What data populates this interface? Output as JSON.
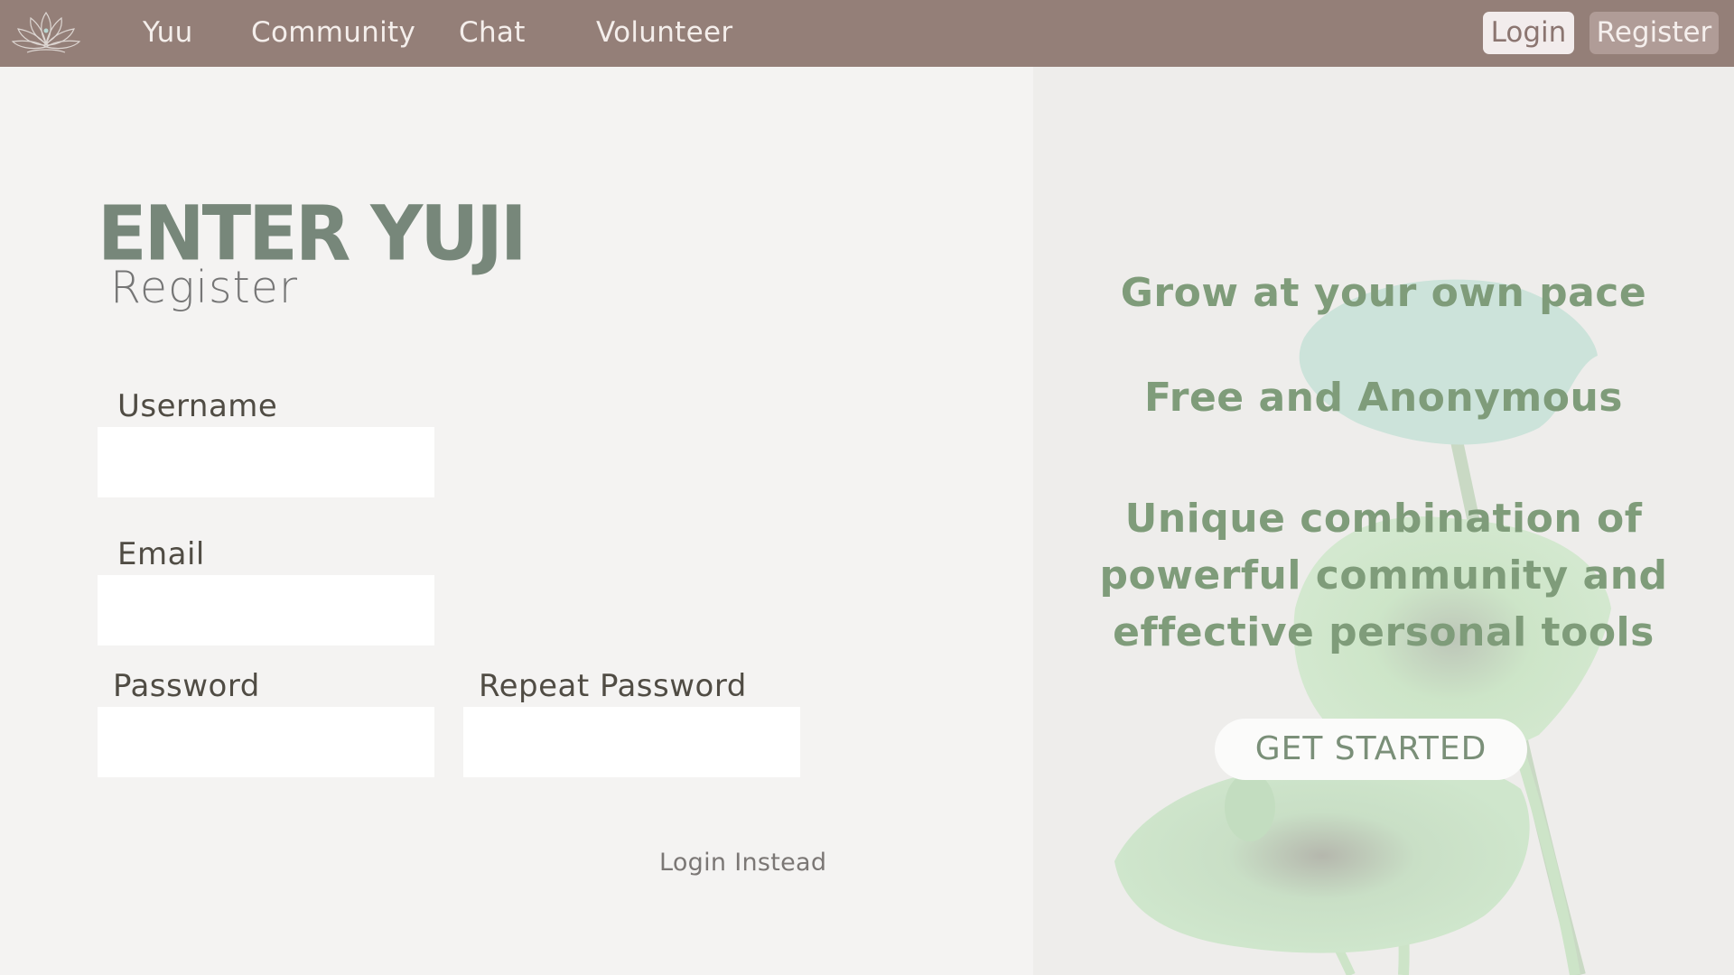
{
  "nav": {
    "links": [
      "Yuu",
      "Community",
      "Chat",
      "Volunteer"
    ],
    "login_label": "Login",
    "register_label": "Register"
  },
  "form": {
    "brand": "ENTER YUJI",
    "subtitle": "Register",
    "username_label": "Username",
    "username_value": "",
    "email_label": "Email",
    "email_value": "",
    "password_label": "Password",
    "password_value": "",
    "repeat_password_label": "Repeat Password",
    "repeat_password_value": "",
    "login_instead": "Login Instead"
  },
  "promo": {
    "line1": "Grow at your own pace",
    "line2": "Free and Anonymous",
    "line3": "Unique combination of powerful community and effective personal tools",
    "cta": "GET STARTED"
  },
  "colors": {
    "navbar": "#947f78",
    "brand_green": "#77877a",
    "promo_green": "#7f9c7a",
    "left_bg": "#f4f3f2",
    "right_bg": "#eeedeb"
  },
  "icons": {
    "logo": "lotus-logo-icon",
    "background_art": "lotus-leaf-illustration"
  }
}
